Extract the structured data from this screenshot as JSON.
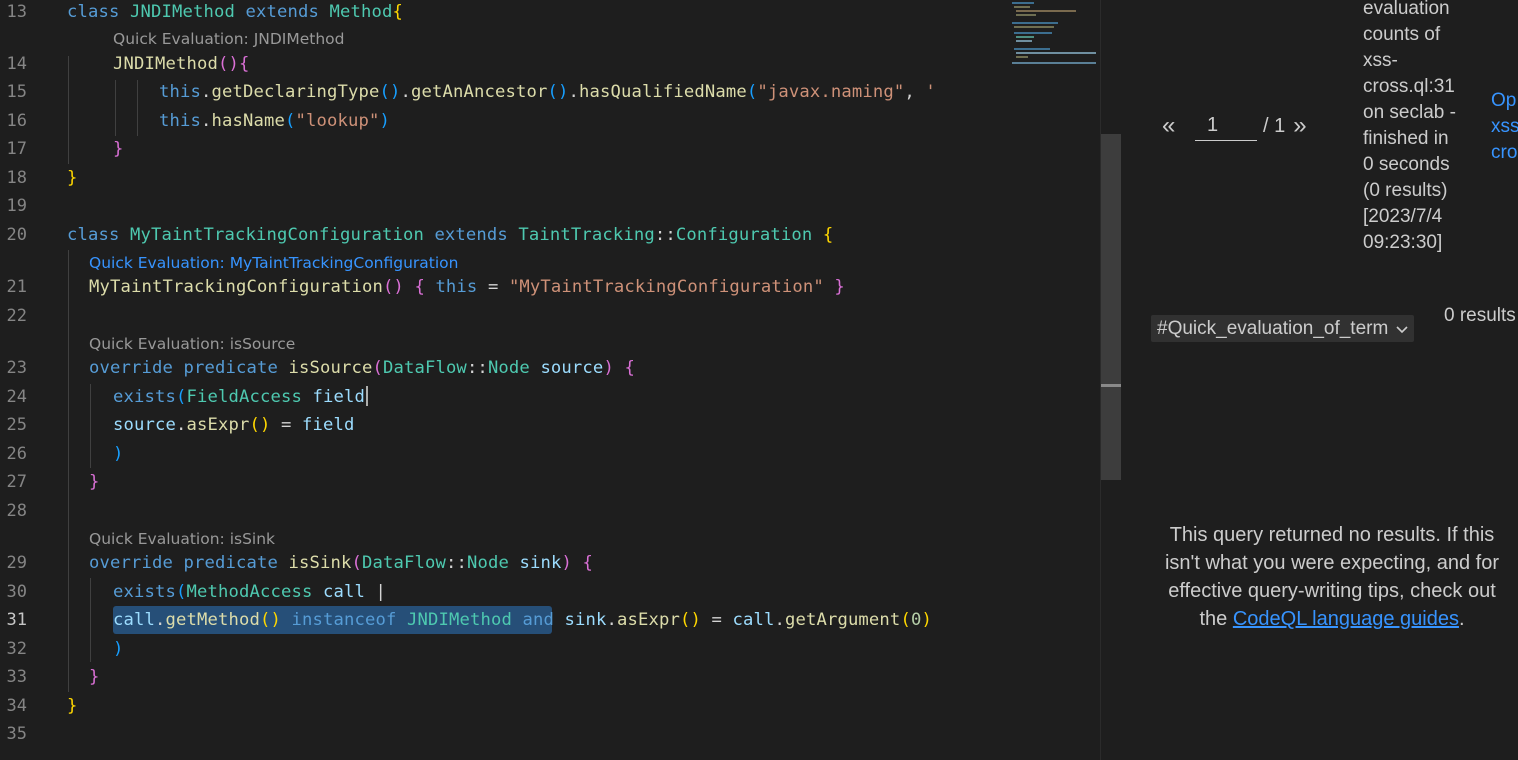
{
  "editor": {
    "line_numbers": [
      "13",
      "14",
      "15",
      "16",
      "17",
      "18",
      "19",
      "20",
      "21",
      "22",
      "23",
      "24",
      "25",
      "26",
      "27",
      "28",
      "29",
      "30",
      "31",
      "32",
      "33",
      "34",
      "35"
    ],
    "active_line": "31",
    "lenses": {
      "jndi": "Quick Evaluation: JNDIMethod",
      "config": "Quick Evaluation: MyTaintTrackingConfiguration",
      "source": "Quick Evaluation: isSource",
      "sink": "Quick Evaluation: isSink"
    },
    "lines": {
      "l13": [
        [
          "kw",
          "class "
        ],
        [
          "ty",
          "JNDIMethod "
        ],
        [
          "kw",
          "extends "
        ],
        [
          "ty",
          "Method"
        ],
        [
          "b1",
          "{"
        ]
      ],
      "l14": [
        [
          "fn",
          "JNDIMethod"
        ],
        [
          "b2",
          "()"
        ],
        [
          "b2",
          "{"
        ]
      ],
      "l15": [
        [
          "kw",
          "this"
        ],
        [
          "tx",
          "."
        ],
        [
          "fn",
          "getDeclaringType"
        ],
        [
          "b3",
          "()"
        ],
        [
          "tx",
          "."
        ],
        [
          "fn",
          "getAnAncestor"
        ],
        [
          "b3",
          "()"
        ],
        [
          "tx",
          "."
        ],
        [
          "fn",
          "hasQualifiedName"
        ],
        [
          "b3",
          "("
        ],
        [
          "st",
          "\"javax.naming\""
        ],
        [
          "tx",
          ", "
        ],
        [
          "st",
          "'"
        ]
      ],
      "l16": [
        [
          "kw",
          "this"
        ],
        [
          "tx",
          "."
        ],
        [
          "fn",
          "hasName"
        ],
        [
          "b3",
          "("
        ],
        [
          "st",
          "\"lookup\""
        ],
        [
          "b3",
          ")"
        ]
      ],
      "l17": [
        [
          "b2",
          "}"
        ]
      ],
      "l18": [
        [
          "b1",
          "}"
        ]
      ],
      "l20": [
        [
          "kw",
          "class "
        ],
        [
          "ty",
          "MyTaintTrackingConfiguration "
        ],
        [
          "kw",
          "extends "
        ],
        [
          "ty",
          "TaintTracking"
        ],
        [
          "tx",
          "::"
        ],
        [
          "ty",
          "Configuration "
        ],
        [
          "b1",
          "{"
        ]
      ],
      "l21": [
        [
          "fn",
          "MyTaintTrackingConfiguration"
        ],
        [
          "b2",
          "() "
        ],
        [
          "b2",
          "{ "
        ],
        [
          "kw",
          "this "
        ],
        [
          "tx",
          "= "
        ],
        [
          "st",
          "\"MyTaintTrackingConfiguration\""
        ],
        [
          "b2",
          " }"
        ]
      ],
      "l23": [
        [
          "kw",
          "override predicate "
        ],
        [
          "fn",
          "isSource"
        ],
        [
          "b2",
          "("
        ],
        [
          "ty",
          "DataFlow"
        ],
        [
          "tx",
          "::"
        ],
        [
          "ty",
          "Node "
        ],
        [
          "va",
          "source"
        ],
        [
          "b2",
          ") "
        ],
        [
          "b2",
          "{"
        ]
      ],
      "l24": [
        [
          "kw",
          "exists"
        ],
        [
          "b3",
          "("
        ],
        [
          "ty",
          "FieldAccess "
        ],
        [
          "va",
          "field"
        ]
      ],
      "l25": [
        [
          "va",
          "source"
        ],
        [
          "tx",
          "."
        ],
        [
          "fn",
          "asExpr"
        ],
        [
          "b1",
          "() "
        ],
        [
          "tx",
          "= "
        ],
        [
          "va",
          "field"
        ]
      ],
      "l26": [
        [
          "b3",
          ")"
        ]
      ],
      "l27": [
        [
          "b2",
          "}"
        ]
      ],
      "l29": [
        [
          "kw",
          "override predicate "
        ],
        [
          "fn",
          "isSink"
        ],
        [
          "b2",
          "("
        ],
        [
          "ty",
          "DataFlow"
        ],
        [
          "tx",
          "::"
        ],
        [
          "ty",
          "Node "
        ],
        [
          "va",
          "sink"
        ],
        [
          "b2",
          ") "
        ],
        [
          "b2",
          "{"
        ]
      ],
      "l30": [
        [
          "kw",
          "exists"
        ],
        [
          "b3",
          "("
        ],
        [
          "ty",
          "MethodAccess "
        ],
        [
          "va",
          "call "
        ],
        [
          "tx",
          "|"
        ]
      ],
      "l31": [
        [
          "va",
          "call"
        ],
        [
          "tx",
          "."
        ],
        [
          "fn",
          "getMethod"
        ],
        [
          "b1",
          "() "
        ],
        [
          "kw",
          "instanceof "
        ],
        [
          "ty",
          "JNDIMethod "
        ],
        [
          "kw",
          "and "
        ],
        [
          "va",
          "sink"
        ],
        [
          "tx",
          "."
        ],
        [
          "fn",
          "asExpr"
        ],
        [
          "b1",
          "() "
        ],
        [
          "tx",
          "= "
        ],
        [
          "va",
          "call"
        ],
        [
          "tx",
          "."
        ],
        [
          "fn",
          "getArgument"
        ],
        [
          "b1",
          "("
        ],
        [
          "nu",
          "0"
        ],
        [
          "b1",
          ")"
        ]
      ],
      "l32": [
        [
          "b3",
          ")"
        ]
      ],
      "l33": [
        [
          "b2",
          "}"
        ]
      ],
      "l34": [
        [
          "b1",
          "}"
        ]
      ]
    }
  },
  "panel": {
    "pager": {
      "prev": "«",
      "page": "1",
      "total": "/ 1",
      "next": "»"
    },
    "eval_message": "evaluation counts of xss-cross.ql:31 on seclab - finished in 0 seconds (0 results) [2023/7/4 09:23:30]",
    "open_link": "Op\nxss\ncro",
    "result_set": "#Quick_evaluation_of_term",
    "result_count": "0 results",
    "no_results": {
      "text": "This query returned no results. If this isn't what you were expecting, and for effective query-writing tips, check out the ",
      "link": "CodeQL language guides",
      "end": "."
    }
  },
  "colors": {
    "background": "#1e1e1e",
    "keyword": "#569cd6",
    "type": "#4ec9b0",
    "function": "#dcdcaa",
    "string": "#ce9178",
    "variable": "#9cdcfe",
    "link": "#3794ff",
    "selection": "#264f78"
  }
}
